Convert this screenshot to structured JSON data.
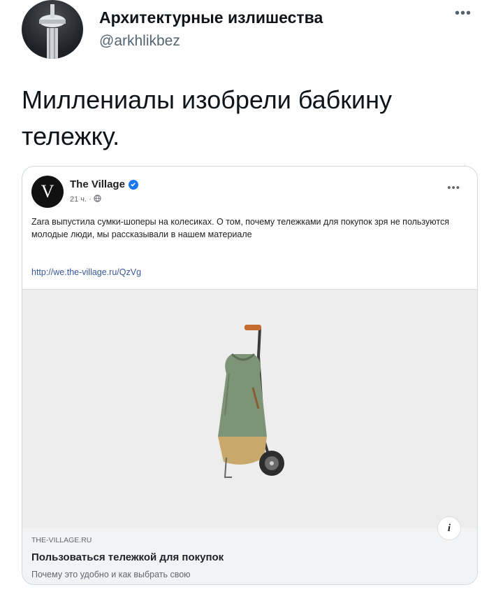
{
  "tweet": {
    "author_name": "Архитектурные излишества",
    "author_handle": "@arkhlikbez",
    "more_icon": "more-horizontal-icon",
    "text": "Миллениалы изобрели бабкину тележку."
  },
  "embedded_post": {
    "page_logo_letter": "V",
    "page_name": "The Village",
    "verified_icon": "verified-badge-icon",
    "time": "21 ч. ·",
    "visibility_icon": "globe-icon",
    "text": "Zara выпустила сумки-шоперы на колесиках. О том, почему тележками для покупок зря не пользуются молодые люди, мы рассказывали в нашем материале",
    "link_text": "http://we.the-village.ru/QzVg",
    "info_icon_glyph": "i",
    "link_card": {
      "domain": "THE-VILLAGE.RU",
      "title": "Пользоваться тележкой для покупок",
      "description": "Почему это удобно и как выбрать свою"
    }
  },
  "colors": {
    "accent_link": "#385898",
    "verified_blue": "#1877f2",
    "handle_gray": "#536471"
  }
}
